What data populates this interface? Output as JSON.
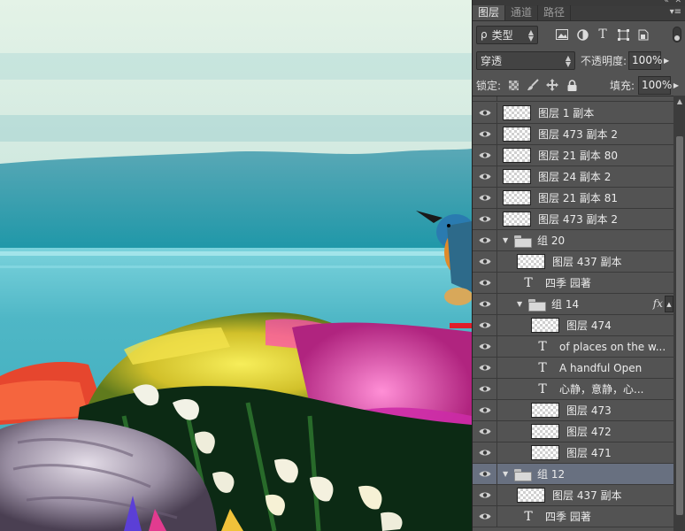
{
  "panel": {
    "tabs": [
      {
        "label": "图层",
        "active": true
      },
      {
        "label": "通道",
        "active": false
      },
      {
        "label": "路径",
        "active": false
      }
    ],
    "top_icons": {
      "collapse": "«",
      "close": "✕"
    },
    "menu_icon": "▾≡",
    "filter": {
      "search_glyph": "ρ",
      "kind_label": "类型"
    },
    "blend_mode": "穿透",
    "opacity_label": "不透明度:",
    "opacity_value": "100%",
    "lock_label": "锁定:",
    "fill_label": "填充:",
    "fill_value": "100%"
  },
  "layers": [
    {
      "type": "pixel",
      "name": "图层 1 副本",
      "depth": 0
    },
    {
      "type": "pixel",
      "name": "图层 473 副本 2",
      "depth": 0
    },
    {
      "type": "pixel",
      "name": "图层 21 副本 80",
      "depth": 0
    },
    {
      "type": "pixel",
      "name": "图层 24 副本 2",
      "depth": 0
    },
    {
      "type": "pixel",
      "name": "图层 21 副本 81",
      "depth": 0
    },
    {
      "type": "pixel",
      "name": "图层 473 副本 2",
      "depth": 0
    },
    {
      "type": "group",
      "name": "组 20",
      "depth": 0
    },
    {
      "type": "pixel",
      "name": "图层 437 副本",
      "depth": 1
    },
    {
      "type": "text",
      "name": "四季 园著",
      "depth": 1
    },
    {
      "type": "group",
      "name": "组 14",
      "depth": 1,
      "fx": "fx"
    },
    {
      "type": "pixel",
      "name": "图层 474",
      "depth": 2
    },
    {
      "type": "text",
      "name": "of places on the w...",
      "depth": 2
    },
    {
      "type": "text",
      "name": "A handful  Open",
      "depth": 2
    },
    {
      "type": "text",
      "name": "心静，意静，心...",
      "depth": 2
    },
    {
      "type": "pixel",
      "name": "图层 473",
      "depth": 2
    },
    {
      "type": "pixel",
      "name": "图层 472",
      "depth": 2
    },
    {
      "type": "pixel",
      "name": "图层 471",
      "depth": 2
    },
    {
      "type": "group",
      "name": "组 12",
      "depth": 0,
      "selected": true
    },
    {
      "type": "pixel",
      "name": "图层 437 副本",
      "depth": 1
    },
    {
      "type": "text",
      "name": "四季 园著",
      "depth": 1
    }
  ]
}
